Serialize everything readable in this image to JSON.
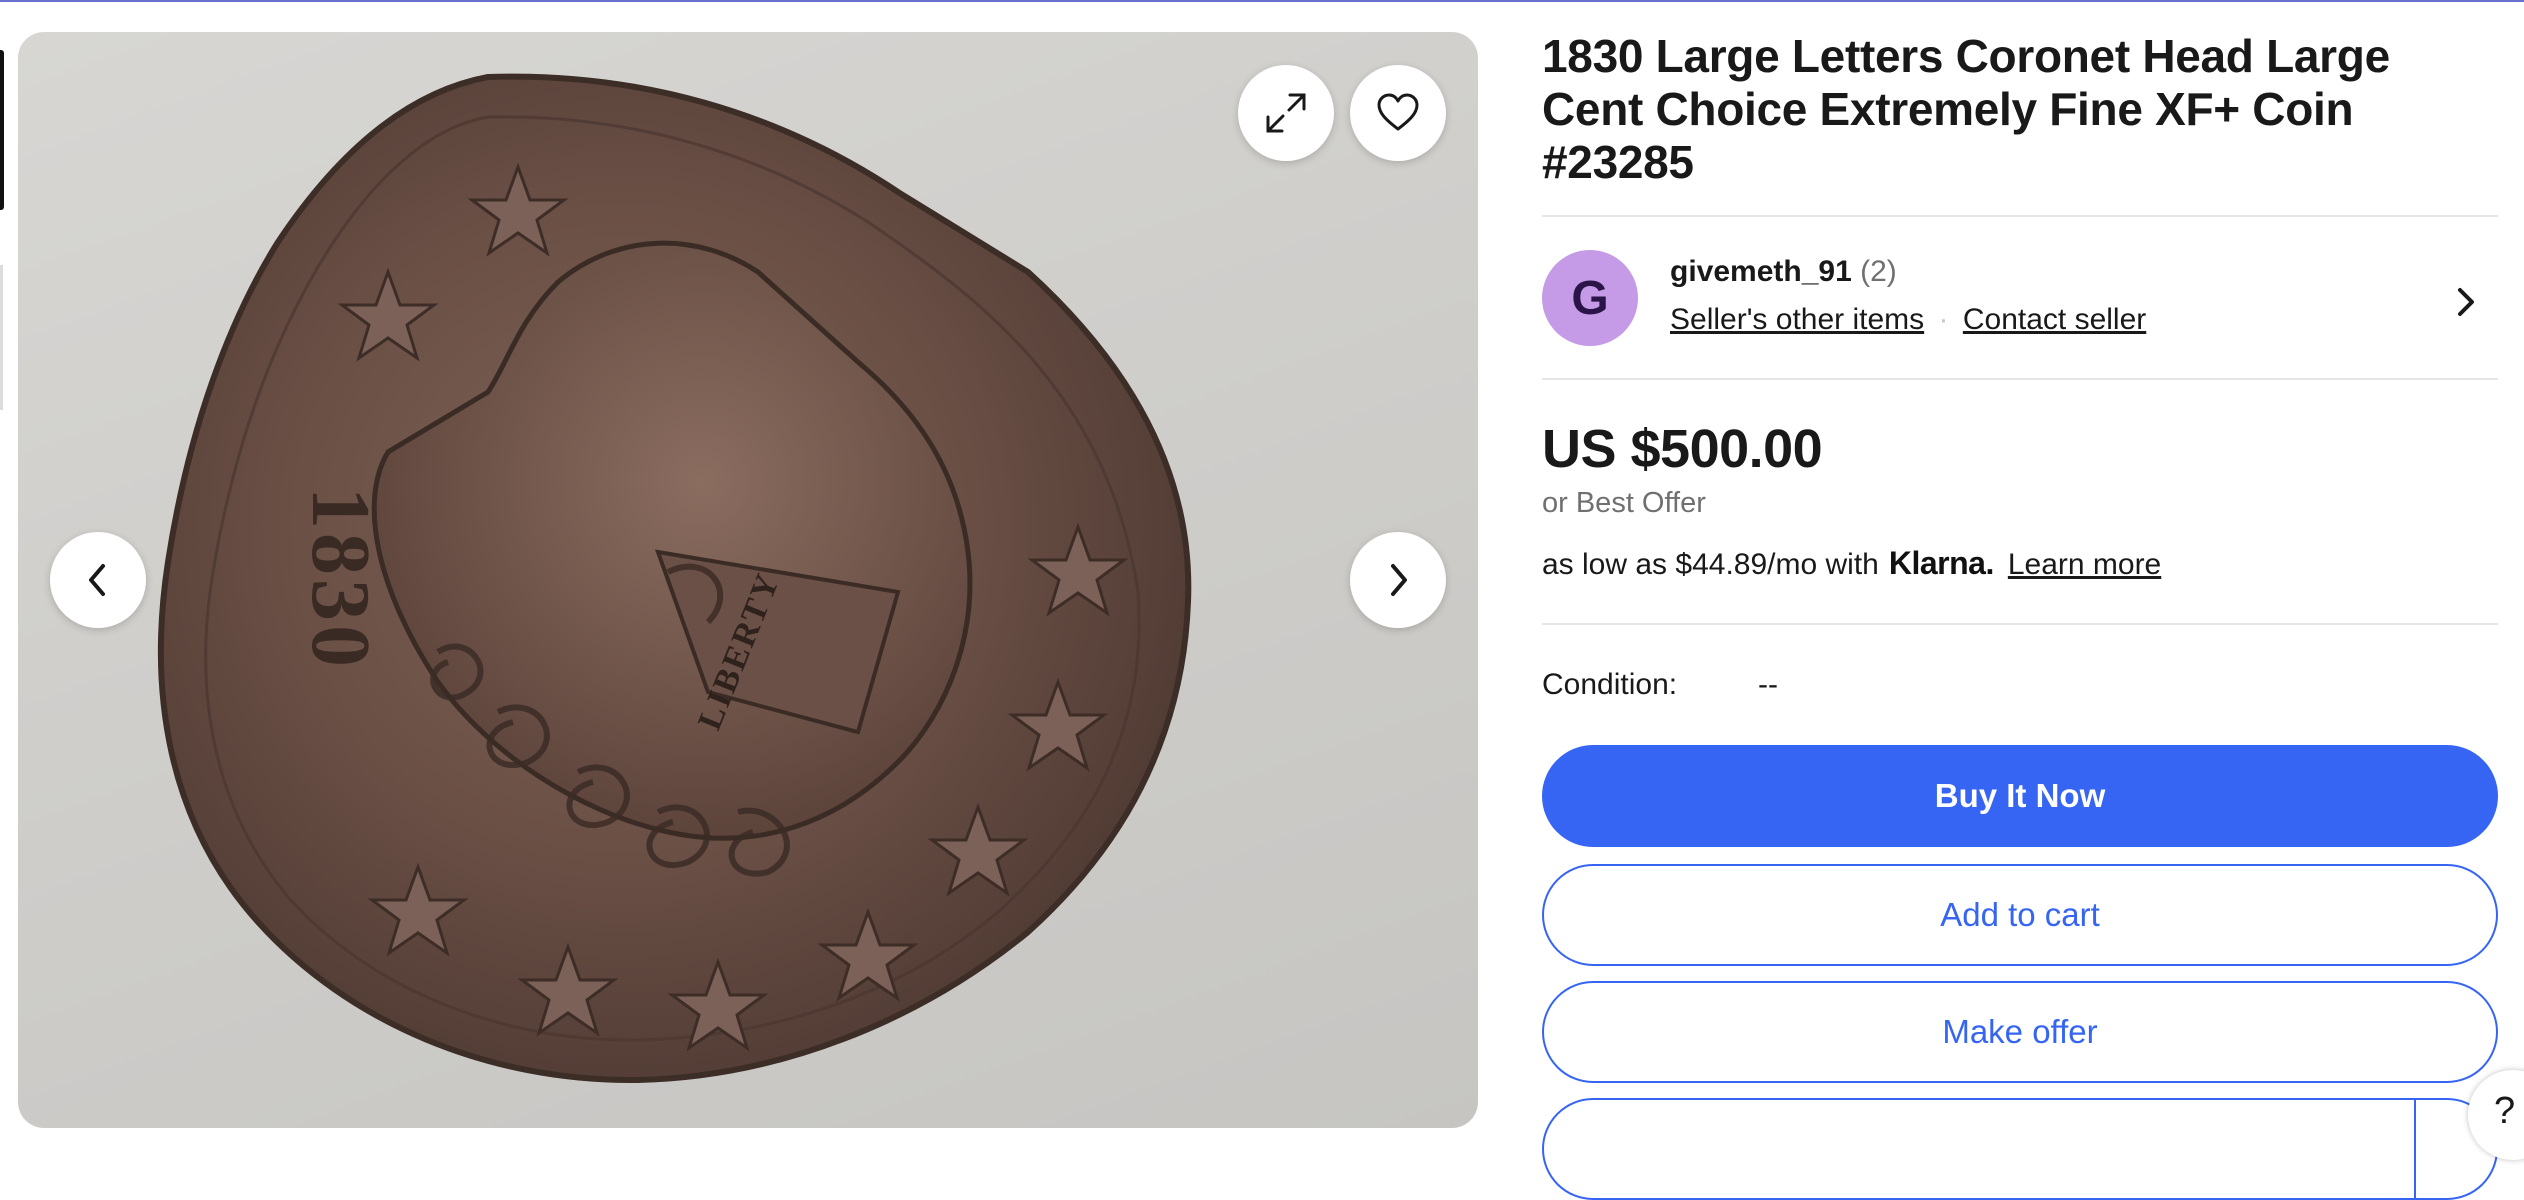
{
  "listing": {
    "title": "1830 Large Letters Coronet Head Large Cent Choice Extremely Fine XF+ Coin #23285"
  },
  "gallery": {
    "coin_date_text": "1830",
    "coin_liberty_text": "LIBERTY",
    "icons": {
      "expand": "expand-icon",
      "watch": "heart-icon",
      "prev": "chevron-left-icon",
      "next": "chevron-right-icon"
    }
  },
  "seller": {
    "avatar_letter": "G",
    "avatar_color": "#c59ae6",
    "name": "givemeth_91",
    "feedback_count": "(2)",
    "other_items_label": "Seller's other items",
    "separator": "·",
    "contact_label": "Contact seller"
  },
  "pricing": {
    "price": "US $500.00",
    "best_offer": "or Best Offer",
    "installment_prefix": "as low as $44.89/mo with",
    "klarna_brand": "Klarna.",
    "learn_more": "Learn more"
  },
  "condition": {
    "label": "Condition:",
    "value": "--"
  },
  "actions": {
    "buy_now": "Buy It Now",
    "add_to_cart": "Add to cart",
    "make_offer": "Make offer"
  },
  "help": {
    "label": "?"
  },
  "colors": {
    "accent": "#3665f3",
    "text": "#191919",
    "muted": "#707070"
  }
}
